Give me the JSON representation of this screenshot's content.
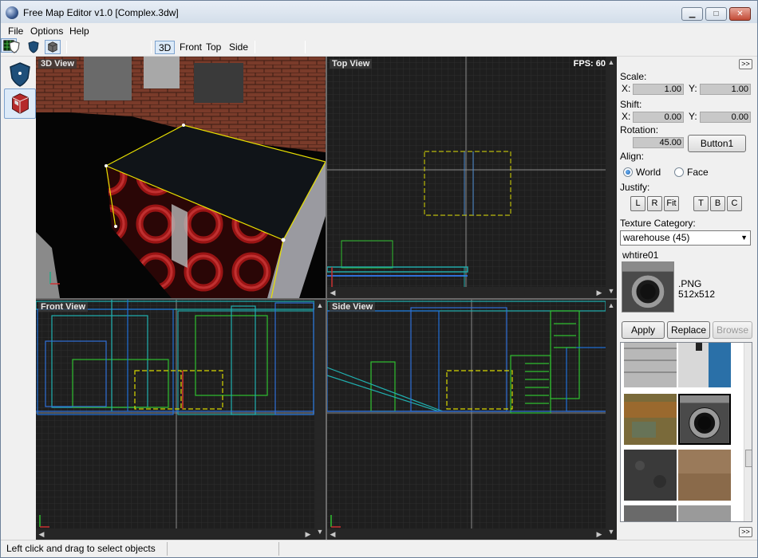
{
  "window": {
    "title": "Free Map Editor v1.0 [Complex.3dw]"
  },
  "menu": [
    "File",
    "Options",
    "Help"
  ],
  "toolbar": {
    "views": [
      "3D",
      "Front",
      "Top",
      "Side"
    ]
  },
  "viewports": {
    "three_d": {
      "label": "3D View",
      "fps": "FPS: 60"
    },
    "top": {
      "label": "Top View"
    },
    "front": {
      "label": "Front View"
    },
    "side": {
      "label": "Side View"
    }
  },
  "panel": {
    "scale_label": "Scale:",
    "scale_x": "1.00",
    "scale_y": "1.00",
    "shift_label": "Shift:",
    "shift_x": "0.00",
    "shift_y": "0.00",
    "rotation_label": "Rotation:",
    "rotation": "45.00",
    "button1": "Button1",
    "x_label": "X:",
    "y_label": "Y:",
    "align_label": "Align:",
    "align_world": "World",
    "align_face": "Face",
    "justify_label": "Justify:",
    "justify": [
      "L",
      "R",
      "Fit",
      "T",
      "B",
      "C"
    ],
    "texture_category_label": "Texture Category:",
    "texture_category": "warehouse (45)",
    "texture_name": "whtire01",
    "texture_format": ".PNG",
    "texture_size": "512x512",
    "apply": "Apply",
    "replace": "Replace",
    "browse": "Browse",
    "expand": ">>"
  },
  "status": {
    "text": "Left click and drag to select objects"
  }
}
